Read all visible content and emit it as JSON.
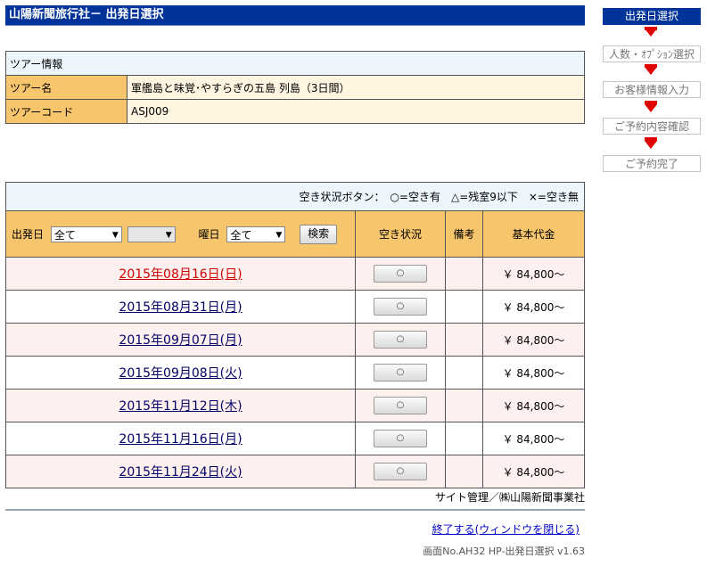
{
  "header": {
    "title": "山陽新聞旅行社－ 出発日選択"
  },
  "tour_info": {
    "section_title": "ツアー情報",
    "rows": [
      {
        "label": "ツアー名",
        "value": "軍艦島と味覚･やすらぎの五島 列島（3日間）"
      },
      {
        "label": "ツアーコード",
        "value": "ASJ009"
      }
    ]
  },
  "legend": "空き状況ボタン：　○=空き有　△=残室9以下　×=空き無",
  "filters": {
    "departure_label": "出発日",
    "departure_value": "全て",
    "second_value": "",
    "weekday_label": "曜日",
    "weekday_value": "全て",
    "search_label": "検索"
  },
  "columns": {
    "availability": "空き状況",
    "remarks": "備考",
    "price": "基本代金"
  },
  "dates": [
    {
      "date": "2015年08月16日(日)",
      "availability": "○",
      "remarks": "",
      "price": "￥ 84,800～"
    },
    {
      "date": "2015年08月31日(月)",
      "availability": "○",
      "remarks": "",
      "price": "￥ 84,800～"
    },
    {
      "date": "2015年09月07日(月)",
      "availability": "○",
      "remarks": "",
      "price": "￥ 84,800～"
    },
    {
      "date": "2015年09月08日(火)",
      "availability": "○",
      "remarks": "",
      "price": "￥ 84,800～"
    },
    {
      "date": "2015年11月12日(木)",
      "availability": "○",
      "remarks": "",
      "price": "￥ 84,800～"
    },
    {
      "date": "2015年11月16日(月)",
      "availability": "○",
      "remarks": "",
      "price": "￥ 84,800～"
    },
    {
      "date": "2015年11月24日(火)",
      "availability": "○",
      "remarks": "",
      "price": "￥ 84,800～"
    }
  ],
  "footer": {
    "site_admin": "サイト管理／㈱山陽新聞事業社",
    "close_link": "終了する(ウィンドウを閉じる)",
    "screen_no": "画面No.AH32 HP-出発日選択 v1.63"
  },
  "steps": [
    "出発日選択",
    "人数・ｵﾌﾟｼｮﾝ選択",
    "お客様情報入力",
    "ご予約内容確認",
    "ご予約完了"
  ],
  "colors": {
    "header_bg": "#003399",
    "label_bg": "#f7c56b",
    "accent_red": "#d10000"
  }
}
